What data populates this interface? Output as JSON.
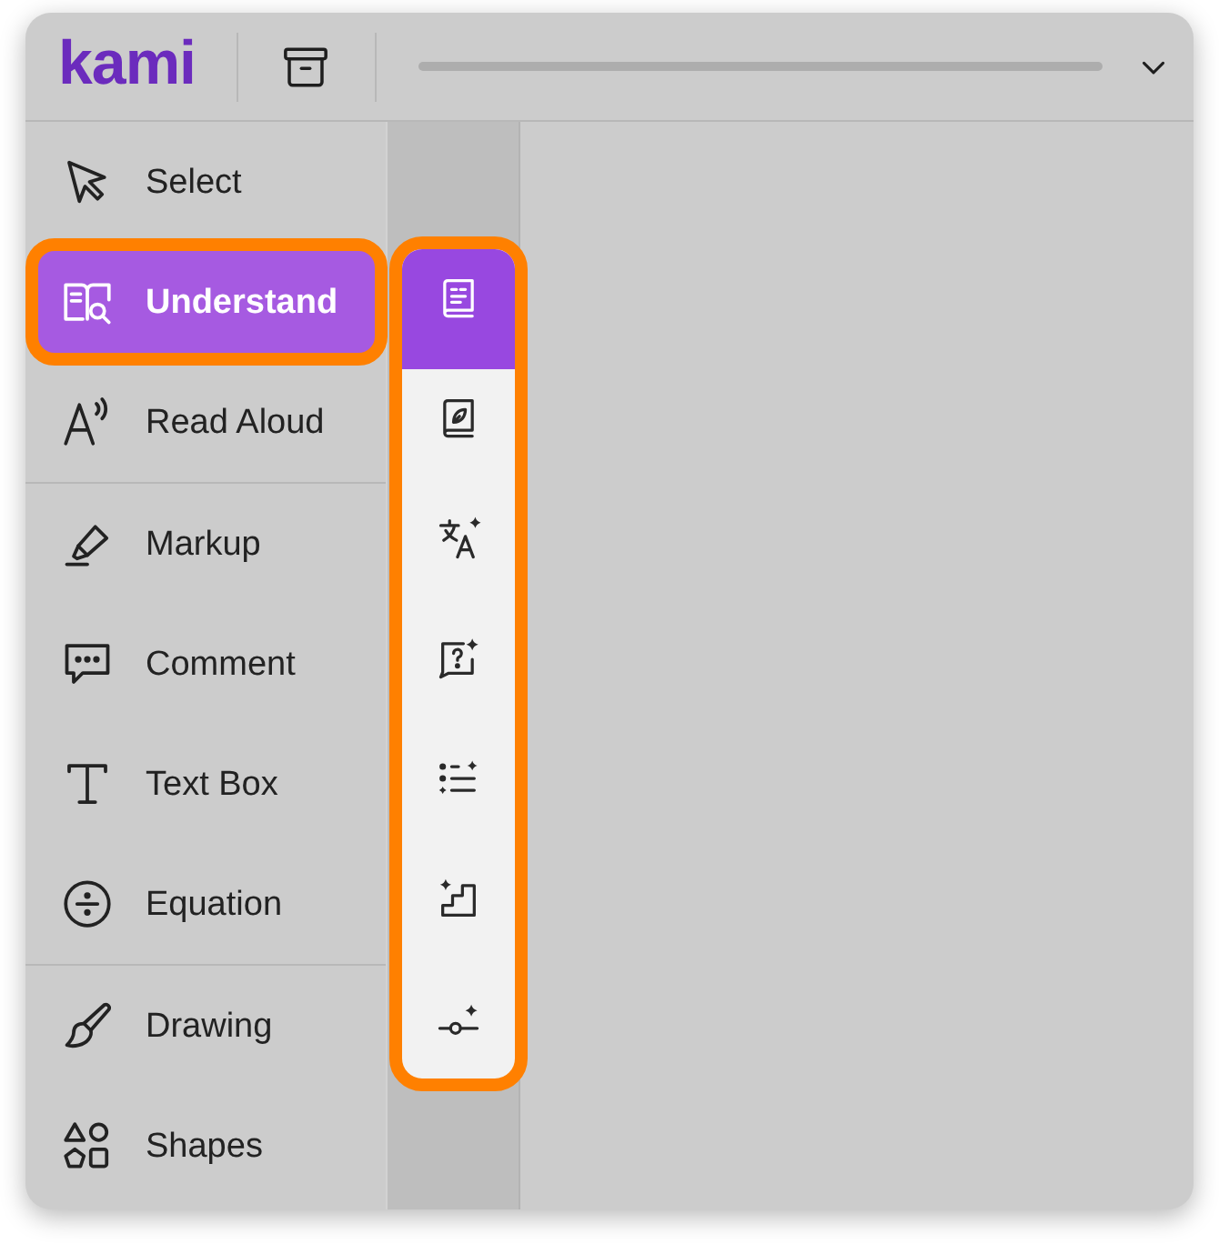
{
  "header": {
    "logo": "kami"
  },
  "sidebar": {
    "groups": [
      {
        "items": [
          {
            "label": "Select",
            "selected": false,
            "highlighted": false
          },
          {
            "label": "Understand",
            "selected": true,
            "highlighted": true
          },
          {
            "label": "Read Aloud",
            "selected": false,
            "highlighted": false
          }
        ]
      },
      {
        "items": [
          {
            "label": "Markup",
            "selected": false,
            "highlighted": false
          },
          {
            "label": "Comment",
            "selected": false,
            "highlighted": false
          },
          {
            "label": "Text Box",
            "selected": false,
            "highlighted": false
          },
          {
            "label": "Equation",
            "selected": false,
            "highlighted": false
          }
        ]
      },
      {
        "items": [
          {
            "label": "Drawing",
            "selected": false,
            "highlighted": false
          },
          {
            "label": "Shapes",
            "selected": false,
            "highlighted": false
          }
        ]
      }
    ]
  },
  "tool_panel": {
    "highlighted": true,
    "items": [
      {
        "selected": true
      },
      {
        "selected": false
      },
      {
        "selected": false
      },
      {
        "selected": false
      },
      {
        "selected": false
      },
      {
        "selected": false
      },
      {
        "selected": false
      }
    ]
  }
}
